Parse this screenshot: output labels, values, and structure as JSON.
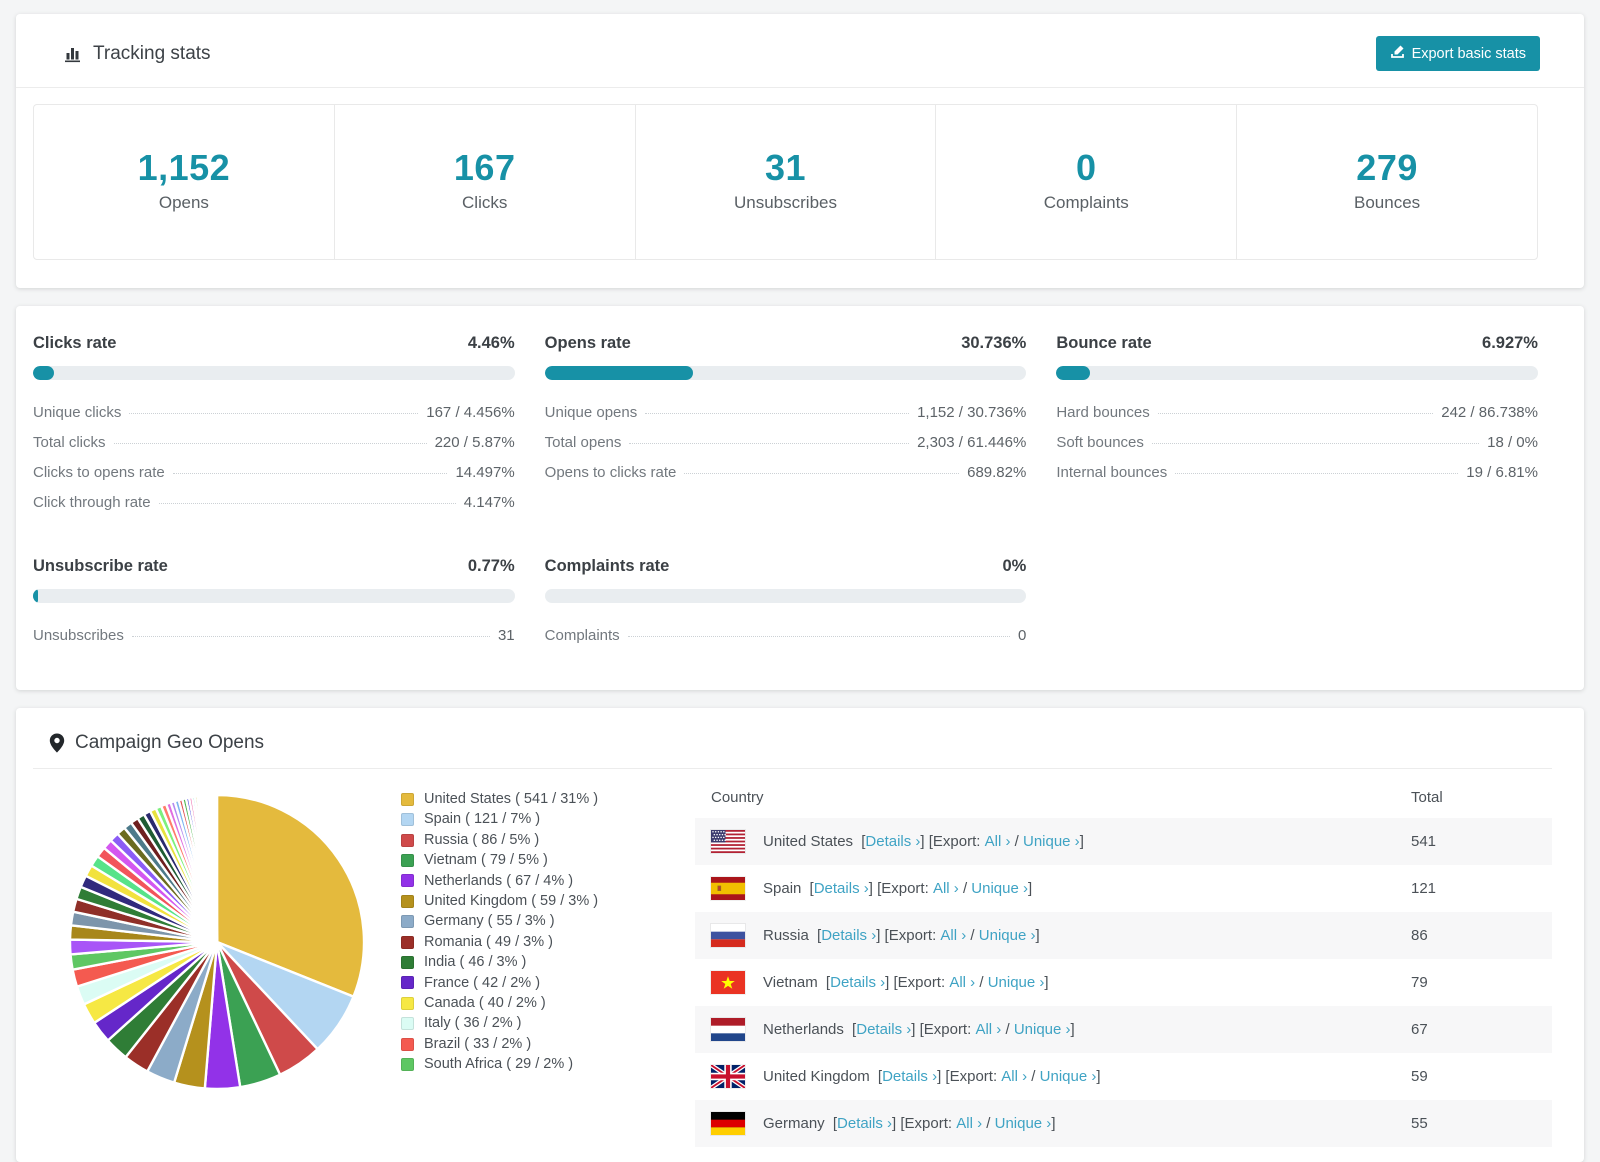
{
  "colors": {
    "accent": "#1791a6",
    "link": "#3fa3c4",
    "bar_track": "#e9edf0",
    "stripe": "#f7f7f8"
  },
  "tracking": {
    "title": "Tracking stats",
    "export_label": "Export basic stats",
    "stats": [
      {
        "value": "1,152",
        "label": "Opens"
      },
      {
        "value": "167",
        "label": "Clicks"
      },
      {
        "value": "31",
        "label": "Unsubscribes"
      },
      {
        "value": "0",
        "label": "Complaints"
      },
      {
        "value": "279",
        "label": "Bounces"
      }
    ]
  },
  "rates": {
    "panels": [
      {
        "title": "Clicks rate",
        "value": "4.46%",
        "percent": 4.46,
        "rows": [
          {
            "label": "Unique clicks",
            "value": "167 / 4.456%"
          },
          {
            "label": "Total clicks",
            "value": "220 / 5.87%"
          },
          {
            "label": "Clicks to opens rate",
            "value": "14.497%"
          },
          {
            "label": "Click through rate",
            "value": "4.147%"
          }
        ]
      },
      {
        "title": "Opens rate",
        "value": "30.736%",
        "percent": 30.736,
        "rows": [
          {
            "label": "Unique opens",
            "value": "1,152 / 30.736%"
          },
          {
            "label": "Total opens",
            "value": "2,303 / 61.446%"
          },
          {
            "label": "Opens to clicks rate",
            "value": "689.82%"
          }
        ]
      },
      {
        "title": "Bounce rate",
        "value": "6.927%",
        "percent": 6.927,
        "rows": [
          {
            "label": "Hard bounces",
            "value": "242 / 86.738%"
          },
          {
            "label": "Soft bounces",
            "value": "18 / 0%"
          },
          {
            "label": "Internal bounces",
            "value": "19 / 6.81%"
          }
        ]
      },
      {
        "title": "Unsubscribe rate",
        "value": "0.77%",
        "percent": 0.77,
        "rows": [
          {
            "label": "Unsubscribes",
            "value": "31"
          }
        ]
      },
      {
        "title": "Complaints rate",
        "value": "0%",
        "percent": 0,
        "rows": [
          {
            "label": "Complaints",
            "value": "0"
          }
        ]
      }
    ]
  },
  "geo": {
    "title": "Campaign Geo Opens",
    "table": {
      "columns": [
        "Country",
        "Total"
      ],
      "links": {
        "details": "Details ›",
        "export_prefix": "Export: ",
        "all": "All ›",
        "slash": " / ",
        "unique": "Unique ›"
      },
      "rows": [
        {
          "country": "United States",
          "flag": "us",
          "total": "541"
        },
        {
          "country": "Spain",
          "flag": "es",
          "total": "121"
        },
        {
          "country": "Russia",
          "flag": "ru",
          "total": "86"
        },
        {
          "country": "Vietnam",
          "flag": "vn",
          "total": "79"
        },
        {
          "country": "Netherlands",
          "flag": "nl",
          "total": "67"
        },
        {
          "country": "United Kingdom",
          "flag": "gb",
          "total": "59"
        },
        {
          "country": "Germany",
          "flag": "de",
          "total": "55"
        }
      ]
    }
  },
  "chart_data": {
    "type": "pie",
    "title": "Campaign Geo Opens",
    "legend_position": "right",
    "start_angle_deg": 0,
    "direction": "clockwise",
    "slices": [
      {
        "label": "United States",
        "value": 541,
        "percent": "31%",
        "color": "#e4ba3d"
      },
      {
        "label": "Spain",
        "value": 121,
        "percent": "7%",
        "color": "#b3d6f2"
      },
      {
        "label": "Russia",
        "value": 86,
        "percent": "5%",
        "color": "#cf4a4a"
      },
      {
        "label": "Vietnam",
        "value": 79,
        "percent": "5%",
        "color": "#3ba153"
      },
      {
        "label": "Netherlands",
        "value": 67,
        "percent": "4%",
        "color": "#9232e8"
      },
      {
        "label": "United Kingdom",
        "value": 59,
        "percent": "3%",
        "color": "#b5911d"
      },
      {
        "label": "Germany",
        "value": 55,
        "percent": "3%",
        "color": "#8cabc8"
      },
      {
        "label": "Romania",
        "value": 49,
        "percent": "3%",
        "color": "#9b2f28"
      },
      {
        "label": "India",
        "value": 46,
        "percent": "3%",
        "color": "#2f7d36"
      },
      {
        "label": "France",
        "value": 42,
        "percent": "2%",
        "color": "#6527c9"
      },
      {
        "label": "Canada",
        "value": 40,
        "percent": "2%",
        "color": "#f6e844"
      },
      {
        "label": "Italy",
        "value": 36,
        "percent": "2%",
        "color": "#dbfcf4"
      },
      {
        "label": "Brazil",
        "value": 33,
        "percent": "2%",
        "color": "#f45a50"
      },
      {
        "label": "South Africa",
        "value": 29,
        "percent": "2%",
        "color": "#5ec763"
      }
    ],
    "others_unlabeled": {
      "note": "long tail of small countries drawn as thin slices, estimated",
      "values": [
        28,
        27,
        26,
        25,
        24,
        23,
        22,
        21,
        20,
        19,
        18,
        17,
        16,
        15,
        14,
        13,
        12,
        11,
        10,
        9,
        8,
        8,
        7,
        7,
        6,
        6,
        5,
        5,
        4,
        4,
        3,
        3,
        3,
        2,
        2,
        2,
        2,
        2,
        1,
        1,
        1,
        1,
        1,
        1,
        1,
        1,
        1,
        1
      ],
      "colors": [
        "#a855f7",
        "#a8871b",
        "#7d95ab",
        "#8f2f28",
        "#2f7d36",
        "#312a7d",
        "#f2e23e",
        "#57e389",
        "#f2545b",
        "#d357f0",
        "#8b5cf6",
        "#6b6b1f",
        "#4d7a8a",
        "#6e1f1f",
        "#1f5c33",
        "#2a2a6e",
        "#e8e23e",
        "#7df07d",
        "#ff7b6b",
        "#e06ee0",
        "#b58cf0",
        "#7db5f0",
        "#e05252",
        "#52b852",
        "#5252e0",
        "#f07db5",
        "#57d0c4",
        "#c0b52a",
        "#9a8fd0",
        "#66a3d6",
        "#e09f52",
        "#52e0a3",
        "#d652c7",
        "#8fd052",
        "#528fd0",
        "#d05273",
        "#73d052",
        "#5273d0",
        "#d0c152",
        "#a352d0",
        "#52d0c1",
        "#d07352",
        "#6ea0b5",
        "#c45fd6",
        "#5fd68e",
        "#d65f5f",
        "#7a5fd6",
        "#d6b55f"
      ]
    }
  }
}
